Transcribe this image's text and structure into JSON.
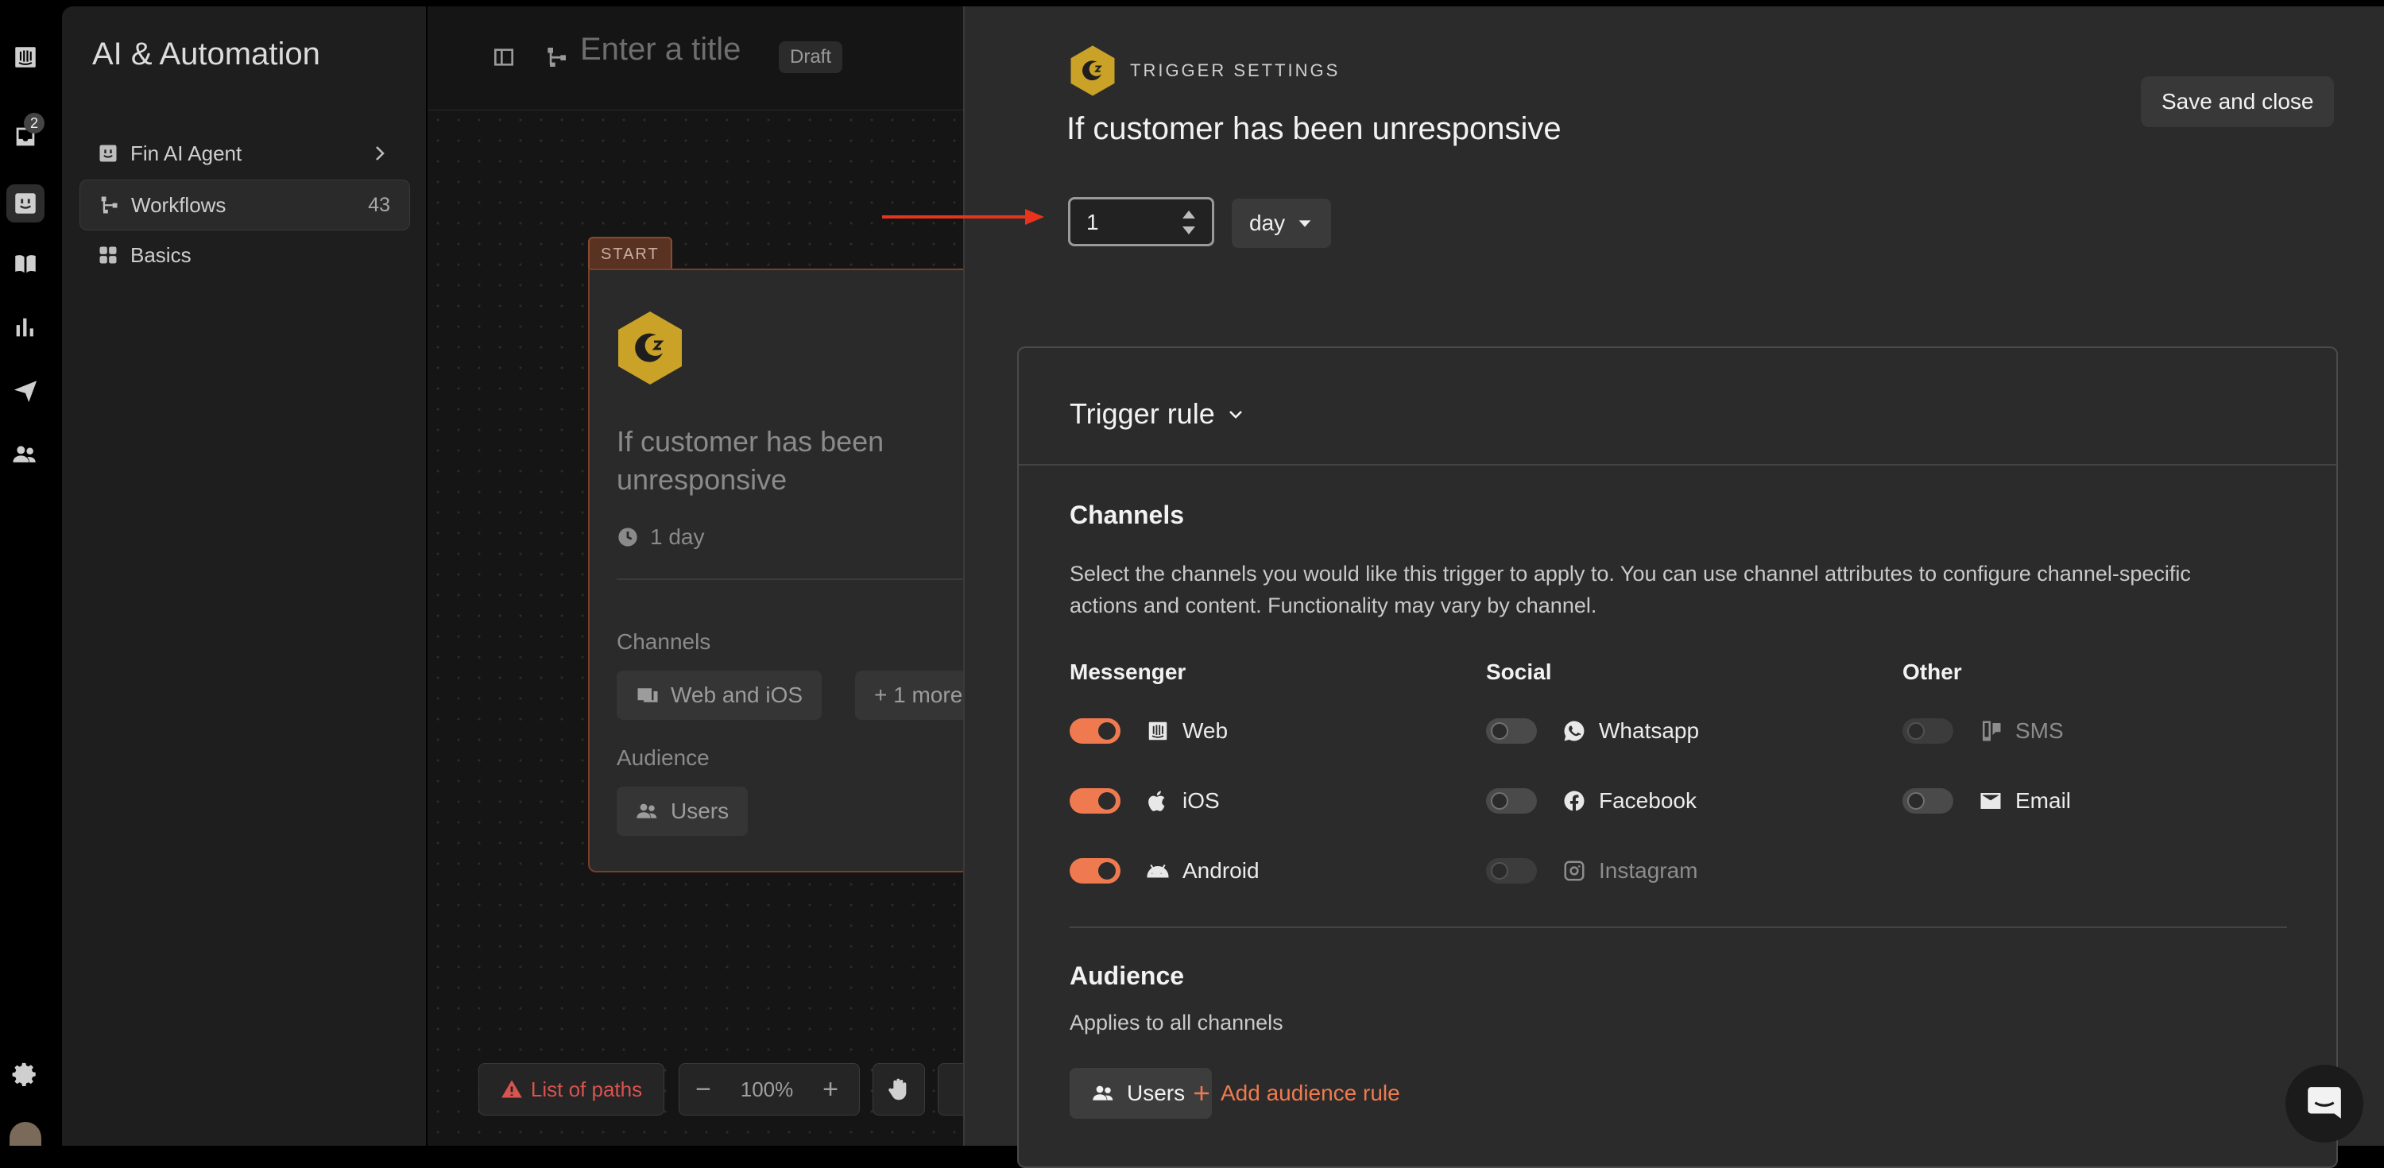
{
  "rail": {
    "inbox_badge": "2"
  },
  "nav": {
    "title": "AI & Automation",
    "items": [
      {
        "label": "Fin AI Agent"
      },
      {
        "label": "Workflows",
        "count": "43"
      },
      {
        "label": "Basics"
      }
    ]
  },
  "editor": {
    "title_placeholder": "Enter a title",
    "status": "Draft"
  },
  "start_card": {
    "tag": "START",
    "title": "If customer has been unresponsive",
    "time": "1 day",
    "channels_label": "Channels",
    "channels_chip": "Web and iOS",
    "more_chip": "+ 1 more",
    "audience_label": "Audience",
    "audience_chip": "Users"
  },
  "toolbar": {
    "list_paths": "List of paths",
    "zoom": "100%",
    "zoom_out": "−",
    "zoom_in": "+"
  },
  "panel": {
    "section_label": "TRIGGER SETTINGS",
    "title": "If customer has been unresponsive",
    "save_close": "Save and close",
    "duration_value": "1",
    "duration_unit": "day",
    "rule_title": "Trigger rule",
    "channels_heading": "Channels",
    "channels_desc": "Select the channels you would like this trigger to apply to. You can use channel attributes to configure channel-specific actions and content. Functionality may vary by channel.",
    "columns": [
      {
        "heading": "Messenger",
        "items": [
          {
            "label": "Web",
            "icon": "intercom-icon",
            "on": true
          },
          {
            "label": "iOS",
            "icon": "apple-icon",
            "on": true
          },
          {
            "label": "Android",
            "icon": "android-icon",
            "on": true
          }
        ]
      },
      {
        "heading": "Social",
        "items": [
          {
            "label": "Whatsapp",
            "icon": "whatsapp-icon",
            "on": false
          },
          {
            "label": "Facebook",
            "icon": "facebook-icon",
            "on": false
          },
          {
            "label": "Instagram",
            "icon": "instagram-icon",
            "on": false,
            "disabled": true
          }
        ]
      },
      {
        "heading": "Other",
        "items": [
          {
            "label": "SMS",
            "icon": "sms-icon",
            "on": false,
            "disabled": true
          },
          {
            "label": "Email",
            "icon": "email-icon",
            "on": false
          }
        ]
      }
    ],
    "audience_heading": "Audience",
    "audience_desc": "Applies to all channels",
    "audience_chip": "Users",
    "add_audience_rule": "Add audience rule"
  },
  "colors": {
    "accent": "#f07a4f",
    "hex_gold": "#c9a227"
  }
}
